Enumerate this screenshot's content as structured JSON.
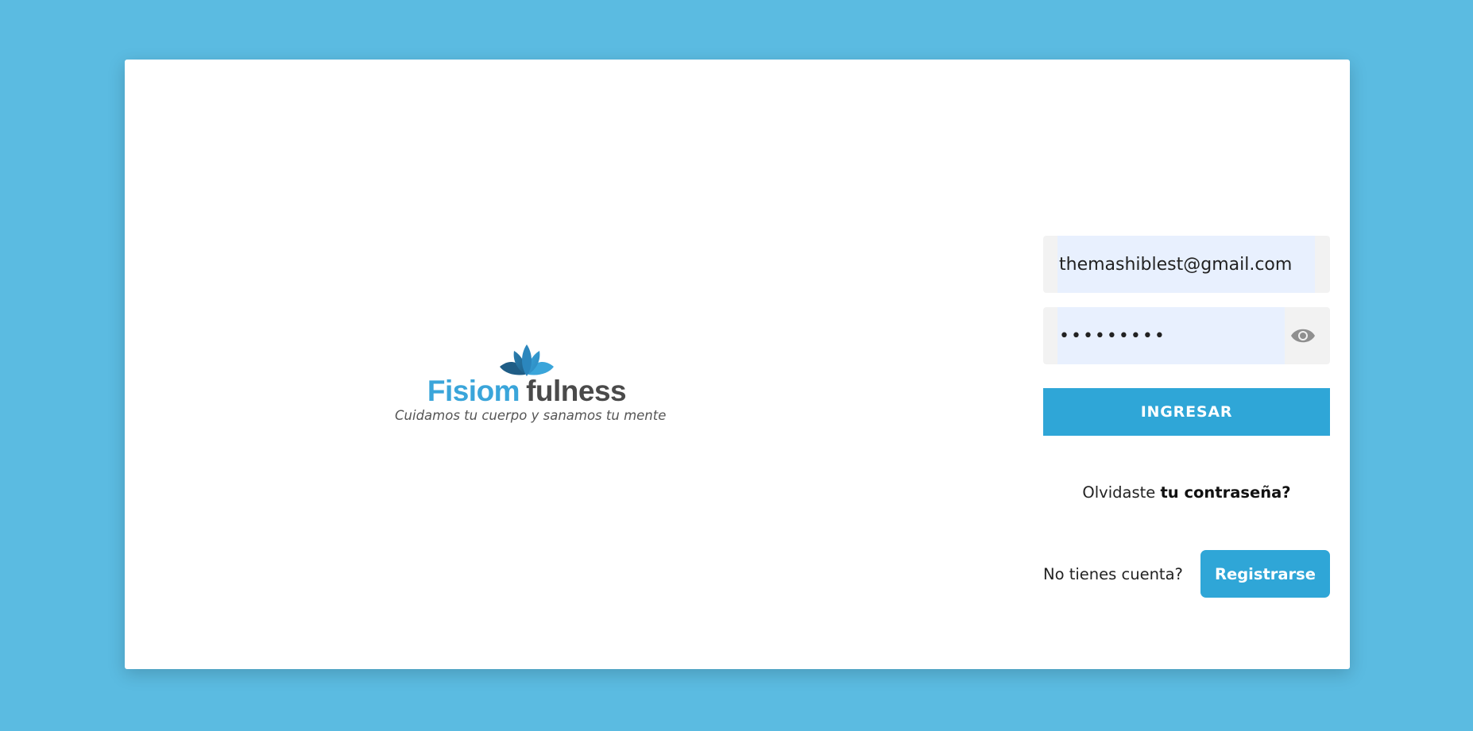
{
  "brand": {
    "name_part1": "Fisiom",
    "name_part2": "fulness",
    "tagline": "Cuidamos tu cuerpo y sanamos tu mente",
    "logo_icon": "lotus-icon",
    "colors": {
      "primary": "#3aa5da",
      "dark": "#4a4a4a"
    }
  },
  "login": {
    "email_value": "themashiblest@gmail.com",
    "password_value": "•••••••••",
    "show_password_icon": "eye-icon",
    "submit_label": "INGRESAR",
    "forgot_prefix": "Olvidaste",
    "forgot_link": "tu contraseña?",
    "no_account_text": "No tienes cuenta?",
    "register_label": "Registrarse"
  },
  "theme": {
    "background": "#5bbbe1",
    "button": "#2fa6d7",
    "card": "#ffffff"
  }
}
